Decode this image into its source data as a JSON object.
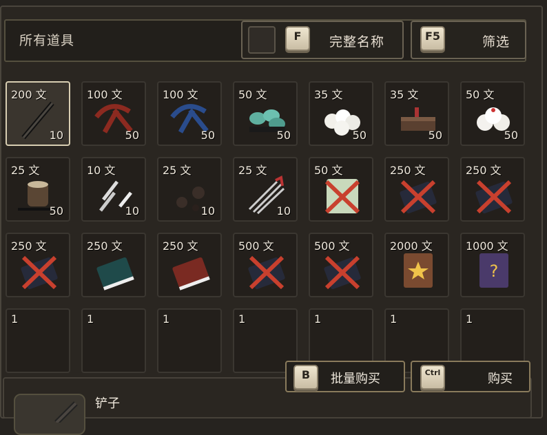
{
  "header": {
    "filter_title": "所有道具",
    "full_name_key": "F",
    "full_name_label": "完整名称",
    "filter_key": "F5",
    "filter_label": "筛选"
  },
  "items": [
    {
      "price": "200 文",
      "qty": "10",
      "icon": "shovel-icon",
      "selected": true
    },
    {
      "price": "100 文",
      "qty": "50",
      "icon": "red-crossbow-icon"
    },
    {
      "price": "100 文",
      "qty": "50",
      "icon": "blue-crossbow-icon"
    },
    {
      "price": "50 文",
      "qty": "50",
      "icon": "teal-stones-icon"
    },
    {
      "price": "35 文",
      "qty": "50",
      "icon": "rice-buns-icon"
    },
    {
      "price": "35 文",
      "qty": "50",
      "icon": "food-tray-icon"
    },
    {
      "price": "50 文",
      "qty": "50",
      "icon": "steamed-buns-icon"
    },
    {
      "price": "25 文",
      "qty": "50",
      "icon": "pot-icon"
    },
    {
      "price": "10 文",
      "qty": "10",
      "icon": "throwing-knives-icon"
    },
    {
      "price": "25 文",
      "qty": "10",
      "icon": "iron-balls-icon"
    },
    {
      "price": "25 文",
      "qty": "10",
      "icon": "needles-icon"
    },
    {
      "price": "50 文",
      "qty": "",
      "icon": "locked-scroll-icon"
    },
    {
      "price": "250 文",
      "qty": "",
      "icon": "locked-book-icon"
    },
    {
      "price": "250 文",
      "qty": "",
      "icon": "locked-book-icon"
    },
    {
      "price": "250 文",
      "qty": "",
      "icon": "locked-book-icon"
    },
    {
      "price": "250 文",
      "qty": "",
      "icon": "teal-book-icon"
    },
    {
      "price": "250 文",
      "qty": "",
      "icon": "red-book-icon"
    },
    {
      "price": "500 文",
      "qty": "",
      "icon": "locked-book-icon"
    },
    {
      "price": "500 文",
      "qty": "",
      "icon": "locked-book-icon"
    },
    {
      "price": "2000 文",
      "qty": "",
      "icon": "star-book-icon"
    },
    {
      "price": "1000 文",
      "qty": "",
      "icon": "mystery-book-icon"
    },
    {
      "price": "1",
      "qty": "",
      "icon": ""
    },
    {
      "price": "1",
      "qty": "",
      "icon": ""
    },
    {
      "price": "1",
      "qty": "",
      "icon": ""
    },
    {
      "price": "1",
      "qty": "",
      "icon": ""
    },
    {
      "price": "1",
      "qty": "",
      "icon": ""
    },
    {
      "price": "1",
      "qty": "",
      "icon": ""
    },
    {
      "price": "1",
      "qty": "",
      "icon": ""
    }
  ],
  "actions": {
    "bulk_key": "B",
    "bulk_label": "批量购买",
    "buy_key": "Ctrl",
    "buy_label": "购买"
  },
  "detail": {
    "name": "铲子"
  },
  "colors": {
    "background": "#26231f",
    "cell_border": "#3b3731",
    "selected_border": "#d9cfb3",
    "forbidden_red": "#c8402e"
  }
}
